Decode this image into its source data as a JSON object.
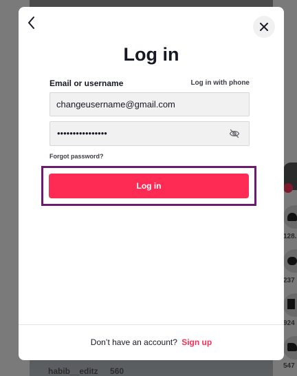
{
  "background": {
    "caption_user": "habib__editz",
    "caption_count": "560",
    "rail_counts": [
      "128.",
      "237",
      "924",
      "547"
    ]
  },
  "modal": {
    "title": "Log in",
    "field_label": "Email or username",
    "phone_link": "Log in with phone",
    "email_value": "changeusername@gmail.com",
    "password_masked": "••••••••••••••••",
    "forgot_label": "Forgot password?",
    "login_label": "Log in",
    "footer_text": "Don’t have an account?",
    "signup_label": "Sign up",
    "icons": {
      "back": "chevron-left-icon",
      "close": "close-icon",
      "eye": "eye-off-icon"
    },
    "colors": {
      "accent": "#fe2c55",
      "highlight": "#6b1a6e"
    }
  }
}
